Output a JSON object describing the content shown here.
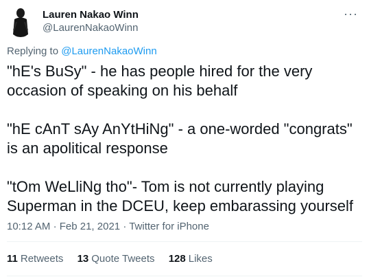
{
  "author": {
    "display_name": "Lauren Nakao Winn",
    "handle": "@LaurenNakaoWinn"
  },
  "replying": {
    "prefix": "Replying to",
    "to": "@LaurenNakaoWinn"
  },
  "tweet": {
    "paragraphs": [
      "\"hE's BuSy\" - he has people hired for the very occasion of speaking on his behalf",
      "\"hE cAnT sAy AnYtHiNg\" - a one-worded \"congrats\" is an apolitical response",
      "\"tOm WeLliNg tho\"- Tom is not currently playing Superman in the DCEU, keep embarassing yourself"
    ],
    "time": "10:12 AM",
    "date": "Feb 21, 2021",
    "source": "Twitter for iPhone"
  },
  "stats": {
    "retweets_count": "11",
    "retweets_label": "Retweets",
    "quotes_count": "13",
    "quotes_label": "Quote Tweets",
    "likes_count": "128",
    "likes_label": "Likes"
  },
  "colors": {
    "accent": "#1d9bf0",
    "text": "#0f1419",
    "muted": "#536471"
  },
  "icons": {
    "more": "more-options-icon"
  }
}
